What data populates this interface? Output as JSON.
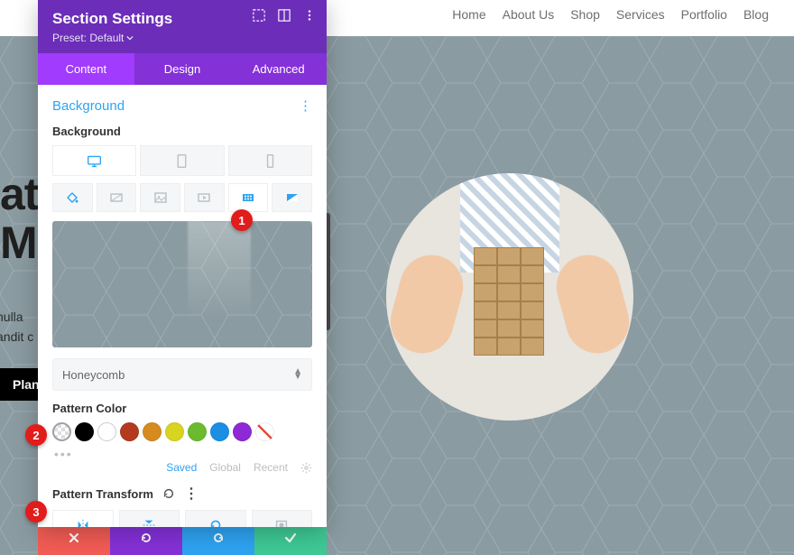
{
  "nav": [
    "Home",
    "About Us",
    "Shop",
    "Services",
    "Portfolio",
    "Blog"
  ],
  "headline": {
    "l1": "at",
    "l2": "Ma"
  },
  "subtext": {
    "l1": "nulla",
    "l2": "andit c"
  },
  "cta_label": "Plann",
  "panel": {
    "title": "Section Settings",
    "preset_label": "Preset: Default",
    "tabs": [
      "Content",
      "Design",
      "Advanced"
    ],
    "active_tab": 0,
    "section": "Background",
    "bg_label": "Background",
    "pattern_select": "Honeycomb",
    "pattern_color_label": "Pattern Color",
    "tags": {
      "saved": "Saved",
      "global": "Global",
      "recent": "Recent"
    },
    "transform_label": "Pattern Transform"
  },
  "steps": [
    "1",
    "2",
    "3"
  ],
  "colors": {
    "accent": "#2ea3f2",
    "primary": "#8431d8",
    "danger": "#e21b1b"
  }
}
